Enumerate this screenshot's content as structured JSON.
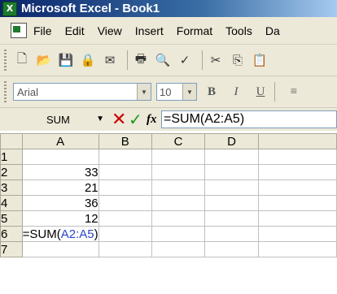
{
  "window": {
    "title": "Microsoft Excel - Book1",
    "app_icon_label": "X"
  },
  "menu": {
    "items": [
      {
        "label": "File"
      },
      {
        "label": "Edit"
      },
      {
        "label": "View"
      },
      {
        "label": "Insert"
      },
      {
        "label": "Format"
      },
      {
        "label": "Tools"
      },
      {
        "label": "Da"
      }
    ]
  },
  "toolbar": {
    "icons": [
      "new-icon",
      "open-icon",
      "save-icon",
      "permission-icon",
      "email-icon",
      "print-icon",
      "print-preview-icon",
      "spelling-icon",
      "cut-icon",
      "copy-icon",
      "paste-icon"
    ],
    "glyphs": {
      "new-icon": "🗋",
      "open-icon": "📂",
      "save-icon": "💾",
      "permission-icon": "🔒",
      "email-icon": "✉",
      "print-icon": "🖶",
      "print-preview-icon": "🔍",
      "spelling-icon": "✓",
      "cut-icon": "✂",
      "copy-icon": "⎘",
      "paste-icon": "📋"
    }
  },
  "formatting": {
    "font_value": "Arial",
    "size_value": "10",
    "bold_label": "B",
    "italic_label": "I",
    "underline_label": "U",
    "align_glyph": "≡"
  },
  "formula_bar": {
    "namebox_value": "SUM",
    "cancel_glyph": "✕",
    "enter_glyph": "✓",
    "fx_label": "fx",
    "formula_value": "=SUM(A2:A5)"
  },
  "sheet": {
    "columns": [
      "A",
      "B",
      "C",
      "D"
    ],
    "rows": [
      {
        "num": "1",
        "a": ""
      },
      {
        "num": "2",
        "a": "33"
      },
      {
        "num": "3",
        "a": "21"
      },
      {
        "num": "4",
        "a": "36"
      },
      {
        "num": "5",
        "a": "12"
      },
      {
        "num": "6",
        "a": ""
      },
      {
        "num": "7",
        "a": ""
      }
    ],
    "edit_formula_prefix": "=SUM(",
    "edit_formula_ref": "A2:A5",
    "edit_formula_suffix": ")"
  },
  "colors": {
    "title_bar": "#0a246a",
    "selection": "#2a46c8",
    "active_header": "#f9d98a"
  }
}
